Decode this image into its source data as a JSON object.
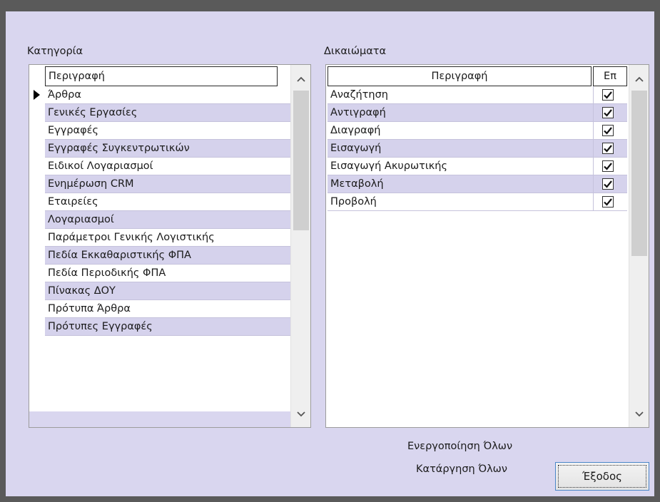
{
  "category_group": {
    "label": "Κατηγορία",
    "header": "Περιγραφή",
    "selected_index": 0,
    "items": [
      "Άρθρα",
      "Γενικές Εργασίες",
      "Εγγραφές",
      "Εγγραφές Συγκεντρωτικών",
      "Ειδικοί Λογαριασμοί",
      "Ενημέρωση CRM",
      "Εταιρείες",
      "Λογαριασμοί",
      "Παράμετροι Γενικής Λογιστικής",
      "Πεδία Εκκαθαριστικής ΦΠΑ",
      "Πεδία Περιοδικής ΦΠΑ",
      "Πίνακας ΔΟΥ",
      "Πρότυπα Άρθρα",
      "Πρότυπες Εγγραφές"
    ]
  },
  "rights_group": {
    "label": "Δικαιώματα",
    "header_description": "Περιγραφή",
    "header_enabled": "Επ",
    "items": [
      {
        "label": "Αναζήτηση",
        "enabled": true
      },
      {
        "label": "Αντιγραφή",
        "enabled": true
      },
      {
        "label": "Διαγραφή",
        "enabled": true
      },
      {
        "label": "Εισαγωγή",
        "enabled": true
      },
      {
        "label": "Εισαγωγή Ακυρωτικής",
        "enabled": true
      },
      {
        "label": "Μεταβολή",
        "enabled": true
      },
      {
        "label": "Προβολή",
        "enabled": true
      }
    ]
  },
  "actions": {
    "enable_all": "Ενεργοποίηση Όλων",
    "disable_all": "Κατάργηση Όλων",
    "exit": "Έξοδος"
  },
  "icons": {
    "scroll_up": "chevron-up-icon",
    "scroll_down": "chevron-down-icon",
    "row_pointer": "triangle-right-icon",
    "check": "checkmark-icon"
  },
  "colors": {
    "window_bg": "#d9d6ef",
    "alt_row": "#d5d2ec",
    "frame": "#5a5a5a"
  }
}
